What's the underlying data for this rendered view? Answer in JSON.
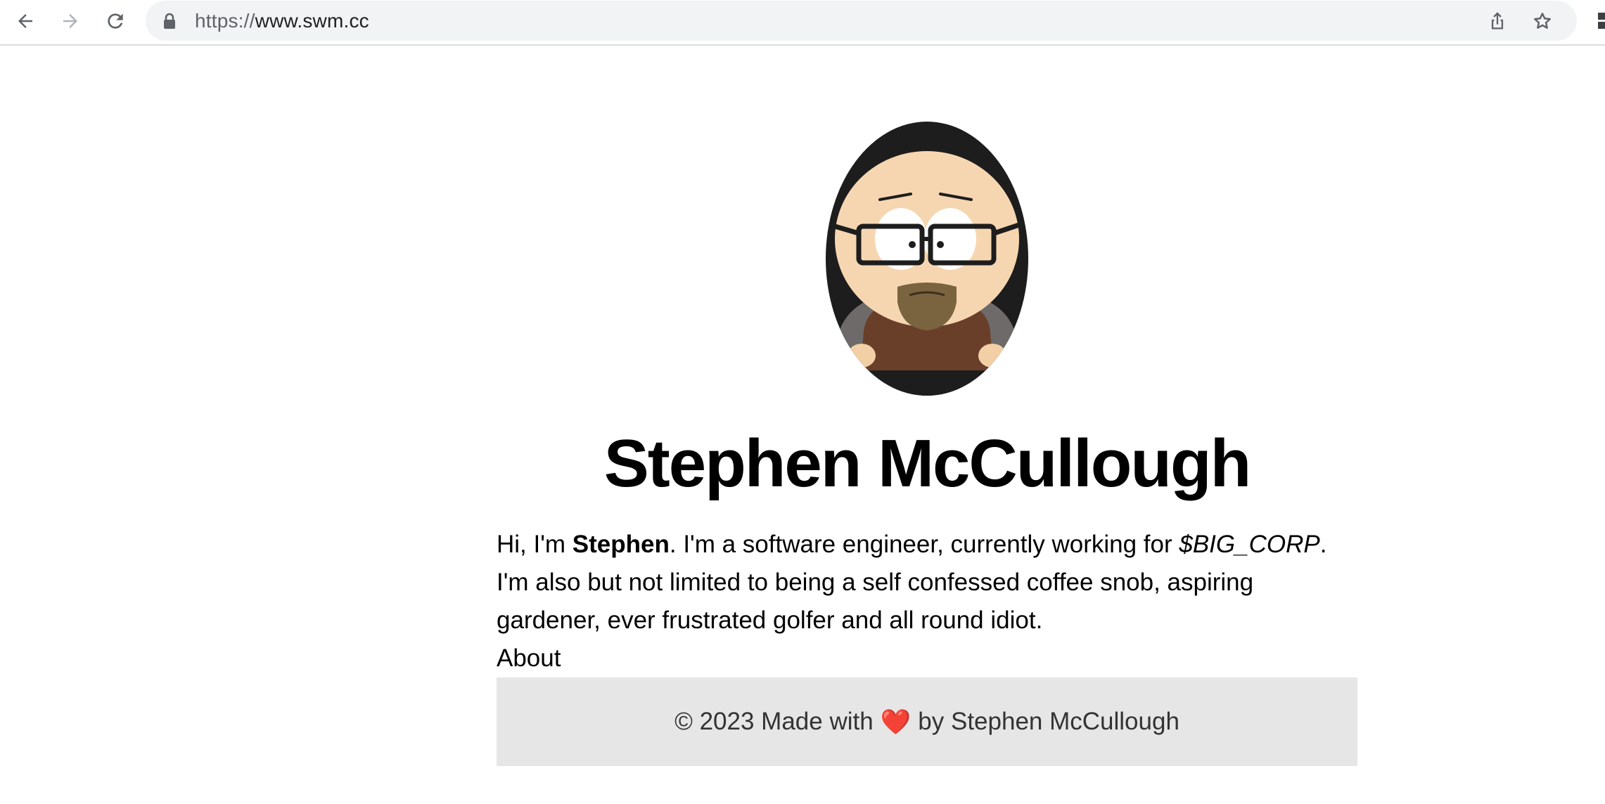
{
  "browser": {
    "url_scheme": "https://",
    "url_host": "www.swm.cc",
    "icons": {
      "back": "back-arrow-icon",
      "forward": "forward-arrow-icon",
      "reload": "reload-icon",
      "lock": "lock-icon",
      "share": "share-icon",
      "bookmark": "star-icon"
    }
  },
  "page": {
    "avatar_icon": "cartoon-avatar",
    "name": "Stephen McCullough",
    "bio": {
      "greeting": "Hi, I'm ",
      "first_name": "Stephen",
      "sentence_1": ". I'm a software engineer, currently working for ",
      "employer": "$BIG_CORP",
      "sentence_2": ". I'm also but not limited to being a self confessed coffee snob, aspiring gardener, ever frustrated golfer and all round idiot."
    },
    "nav": {
      "about_label": "About"
    },
    "footer": {
      "prefix": "© 2023 Made with",
      "heart": "❤️",
      "suffix": "by Stephen McCullough"
    }
  },
  "colors": {
    "footer_bg": "#e6e6e6",
    "heart": "#d0021b",
    "omnibox_bg": "#f1f3f4"
  }
}
